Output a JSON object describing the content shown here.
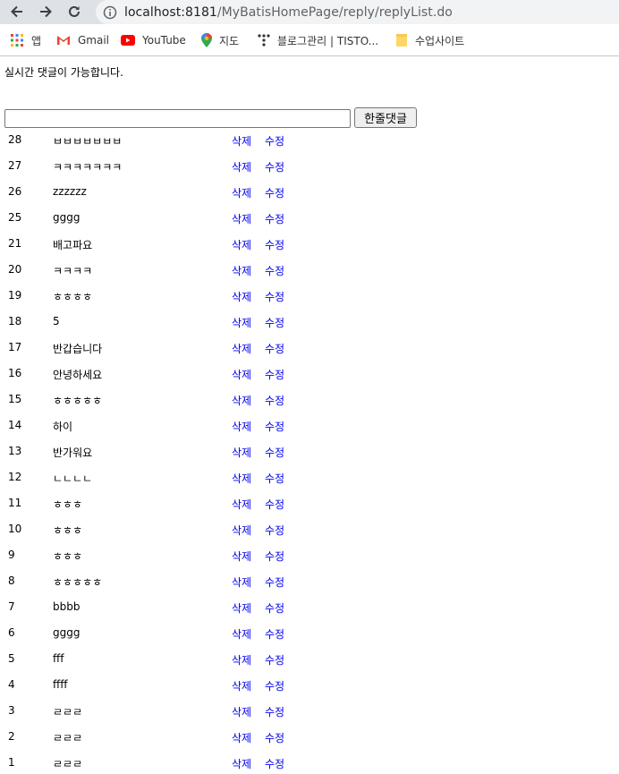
{
  "browser": {
    "url_host": "localhost:8181",
    "url_path": "/MyBatisHomePage/reply/replyList.do"
  },
  "bookmarks": [
    {
      "label": "앱",
      "icon": "apps-grid-icon"
    },
    {
      "label": "Gmail",
      "icon": "gmail-icon"
    },
    {
      "label": "YouTube",
      "icon": "youtube-icon"
    },
    {
      "label": "지도",
      "icon": "maps-pin-icon"
    },
    {
      "label": "블로그관리 | TISTO...",
      "icon": "tistory-icon"
    },
    {
      "label": "수업사이트",
      "icon": "folder-icon"
    }
  ],
  "page": {
    "intro": "실시간 댓글이 가능합니다.",
    "input_value": "",
    "submit_label": "한줄댓글",
    "delete_label": "삭제",
    "edit_label": "수정"
  },
  "replies": [
    {
      "num": "28",
      "content": "ㅂㅂㅂㅂㅂㅂㅂ"
    },
    {
      "num": "27",
      "content": "ㅋㅋㅋㅋㅋㅋㅋ"
    },
    {
      "num": "26",
      "content": "zzzzzz"
    },
    {
      "num": "25",
      "content": "gggg"
    },
    {
      "num": "21",
      "content": "배고파요"
    },
    {
      "num": "20",
      "content": "ㅋㅋㅋㅋ"
    },
    {
      "num": "19",
      "content": "ㅎㅎㅎㅎ"
    },
    {
      "num": "18",
      "content": "5"
    },
    {
      "num": "17",
      "content": "반갑습니다"
    },
    {
      "num": "16",
      "content": "안녕하세요"
    },
    {
      "num": "15",
      "content": "ㅎㅎㅎㅎㅎ"
    },
    {
      "num": "14",
      "content": "하이"
    },
    {
      "num": "13",
      "content": "반가워요"
    },
    {
      "num": "12",
      "content": "ㄴㄴㄴㄴ"
    },
    {
      "num": "11",
      "content": "ㅎㅎㅎ"
    },
    {
      "num": "10",
      "content": "ㅎㅎㅎ"
    },
    {
      "num": "9",
      "content": "ㅎㅎㅎ"
    },
    {
      "num": "8",
      "content": "ㅎㅎㅎㅎㅎ"
    },
    {
      "num": "7",
      "content": "bbbb"
    },
    {
      "num": "6",
      "content": "gggg"
    },
    {
      "num": "5",
      "content": "fff"
    },
    {
      "num": "4",
      "content": "ffff"
    },
    {
      "num": "3",
      "content": "ㄹㄹㄹ"
    },
    {
      "num": "2",
      "content": "ㄹㄹㄹ"
    },
    {
      "num": "1",
      "content": "ㄹㄹㄹ"
    }
  ]
}
